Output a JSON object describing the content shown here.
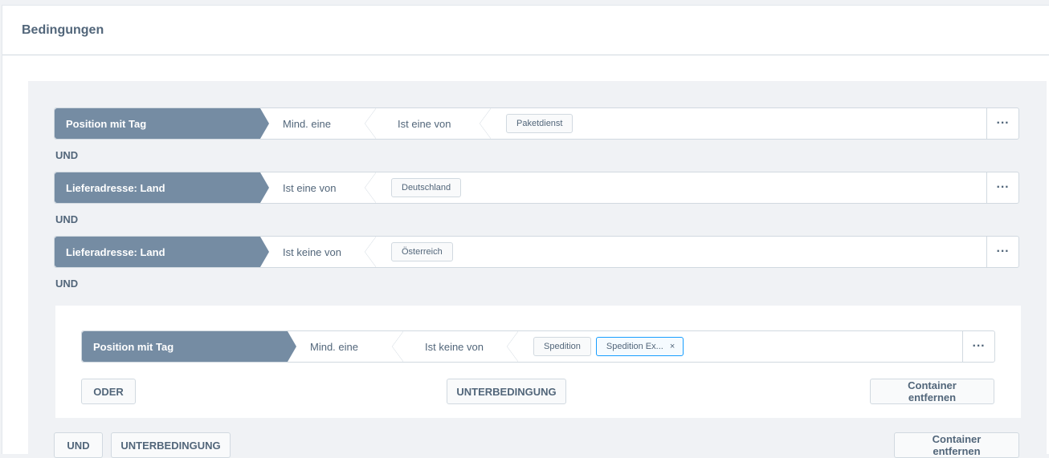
{
  "card": {
    "title": "Bedingungen"
  },
  "conditions": [
    {
      "field": "Position mit Tag",
      "op1": "Mind. eine",
      "op2": "Ist eine von",
      "values": [
        "Paketdienst"
      ]
    },
    {
      "field": "Lieferadresse: Land",
      "op1": "Ist eine von",
      "values": [
        "Deutschland"
      ]
    },
    {
      "field": "Lieferadresse: Land",
      "op1": "Ist keine von",
      "values": [
        "Österreich"
      ]
    }
  ],
  "connector": "UND",
  "inner": {
    "condition": {
      "field": "Position mit Tag",
      "op1": "Mind. eine",
      "op2": "Ist keine von",
      "values": [
        "Spedition",
        "Spedition Ex..."
      ]
    },
    "remove_tag_symbol": "×",
    "buttons": {
      "or": "ODER",
      "sub": "UNTERBEDINGUNG",
      "remove": "Container entfernen"
    }
  },
  "outer_buttons": {
    "and": "UND",
    "sub": "UNTERBEDINGUNG",
    "remove": "Container entfernen"
  },
  "menu_symbol": "···"
}
